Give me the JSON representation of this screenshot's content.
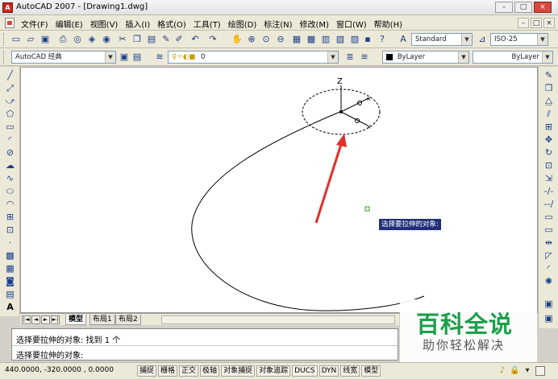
{
  "window": {
    "title": "AutoCAD 2007 - [Drawing1.dwg]",
    "app_icon_glyph": "A",
    "controls": [
      "–",
      "□",
      "×"
    ]
  },
  "menu": {
    "items": [
      "文件(F)",
      "编辑(E)",
      "视图(V)",
      "插入(I)",
      "格式(O)",
      "工具(T)",
      "绘图(D)",
      "标注(N)",
      "修改(M)",
      "窗口(W)",
      "帮助(H)"
    ],
    "mdi_controls": [
      "–",
      "□",
      "×"
    ]
  },
  "toolbar_standard": {
    "text_style": "Standard",
    "dim_style": "ISO-25"
  },
  "toolbar_layers": {
    "workspace": "AutoCAD 经典",
    "layer": "0",
    "color": "ByLayer",
    "linetype": "ByLayer"
  },
  "layout_tabs": {
    "nav": [
      "|◄",
      "◄",
      "►",
      "►|"
    ],
    "tabs": [
      "模型",
      "布局1",
      "布局2"
    ]
  },
  "canvas": {
    "ucs_label": "Z",
    "tooltip": "选择要拉伸的对象:"
  },
  "command": {
    "line1": "选择要拉伸的对象: 找到 1 个",
    "line2": "选择要拉伸的对象:"
  },
  "watermark": {
    "title": "百科全说",
    "subtitle": "助你轻松解决"
  },
  "status": {
    "coords": "440.0000,  -320.0000 , 0.0000",
    "buttons": [
      "捕捉",
      "栅格",
      "正交",
      "极轴",
      "对象捕捉",
      "对象追踪",
      "DUCS",
      "DYN",
      "线宽",
      "模型"
    ]
  },
  "colors": {
    "accent": "#1a3f8a",
    "arrow": "#e0302a",
    "tooltip_bg": "#1f2f7a",
    "watermark": "#1aa04a"
  }
}
